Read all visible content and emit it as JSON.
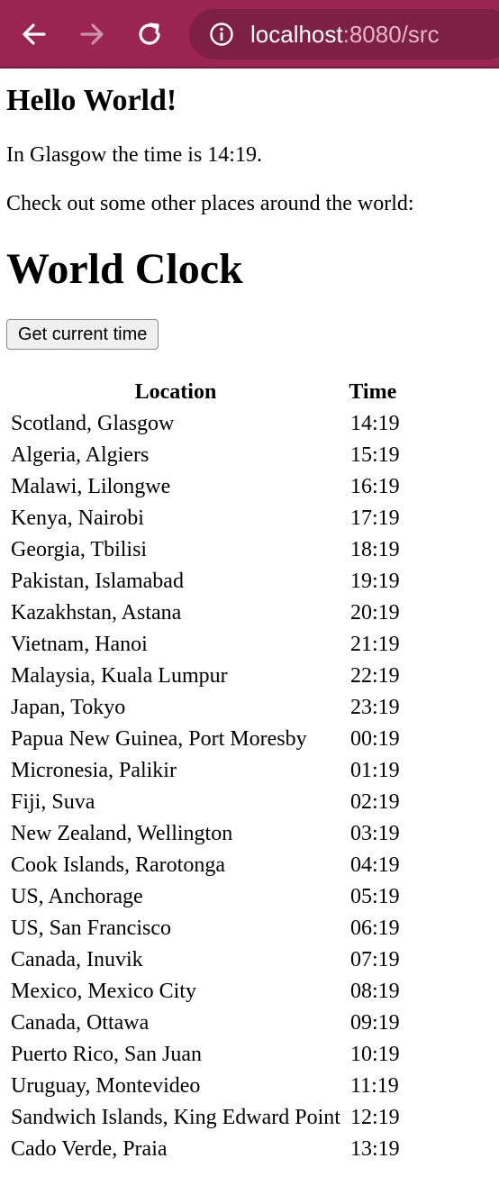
{
  "browser": {
    "url_host": "localhost",
    "url_rest": ":8080/src",
    "icons": [
      "back-arrow-icon",
      "forward-arrow-icon",
      "reload-icon",
      "info-icon"
    ]
  },
  "page": {
    "heading": "Hello World!",
    "glasgow_text": "In Glasgow the time is 14:19.",
    "check_text": "Check out some other places around the world:",
    "clock_heading": "World Clock",
    "button_label": "Get current time"
  },
  "table": {
    "headers": [
      "Location",
      "Time"
    ],
    "rows": [
      {
        "location": "Scotland, Glasgow",
        "time": "14:19"
      },
      {
        "location": "Algeria, Algiers",
        "time": "15:19"
      },
      {
        "location": "Malawi, Lilongwe",
        "time": "16:19"
      },
      {
        "location": "Kenya, Nairobi",
        "time": "17:19"
      },
      {
        "location": "Georgia, Tbilisi",
        "time": "18:19"
      },
      {
        "location": "Pakistan, Islamabad",
        "time": "19:19"
      },
      {
        "location": "Kazakhstan, Astana",
        "time": "20:19"
      },
      {
        "location": "Vietnam, Hanoi",
        "time": "21:19"
      },
      {
        "location": "Malaysia, Kuala Lumpur",
        "time": "22:19"
      },
      {
        "location": "Japan, Tokyo",
        "time": "23:19"
      },
      {
        "location": "Papua New Guinea, Port Moresby",
        "time": "00:19"
      },
      {
        "location": "Micronesia, Palikir",
        "time": "01:19"
      },
      {
        "location": "Fiji, Suva",
        "time": "02:19"
      },
      {
        "location": "New Zealand, Wellington",
        "time": "03:19"
      },
      {
        "location": "Cook Islands, Rarotonga",
        "time": "04:19"
      },
      {
        "location": "US, Anchorage",
        "time": "05:19"
      },
      {
        "location": "US, San Francisco",
        "time": "06:19"
      },
      {
        "location": "Canada, Inuvik",
        "time": "07:19"
      },
      {
        "location": "Mexico, Mexico City",
        "time": "08:19"
      },
      {
        "location": "Canada, Ottawa",
        "time": "09:19"
      },
      {
        "location": "Puerto Rico, San Juan",
        "time": "10:19"
      },
      {
        "location": "Uruguay, Montevideo",
        "time": "11:19"
      },
      {
        "location": "Sandwich Islands, King Edward Point",
        "time": "12:19"
      },
      {
        "location": "Cado Verde, Praia",
        "time": "13:19"
      }
    ]
  },
  "colors": {
    "toolbar": "#9b2552",
    "url_box": "#7e1f45"
  }
}
